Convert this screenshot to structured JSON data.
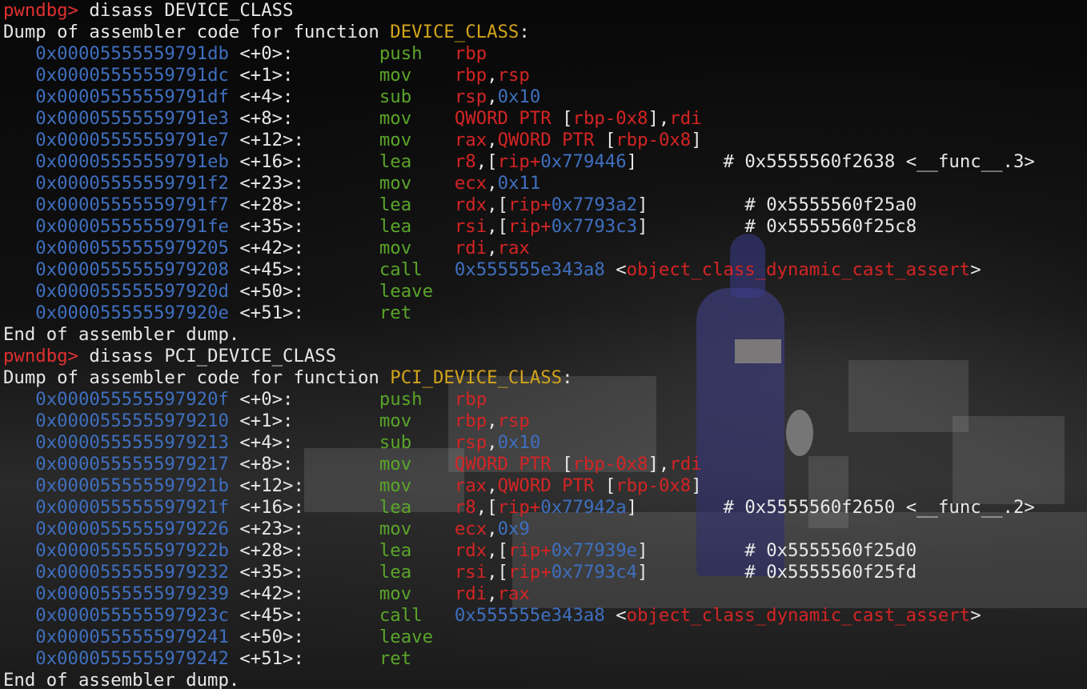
{
  "terminal": {
    "prompt": "pwndbg>",
    "sections": [
      {
        "command": "disass DEVICE_CLASS",
        "header_prefix": "Dump of assembler code for function ",
        "function": "DEVICE_CLASS",
        "header_suffix": ":",
        "rows": [
          {
            "addr": "0x00005555559791db",
            "off": "<+0>:",
            "mn": "push",
            "ops": [
              {
                "t": "rbp",
                "c": "reg"
              }
            ],
            "comment": ""
          },
          {
            "addr": "0x00005555559791dc",
            "off": "<+1>:",
            "mn": "mov",
            "ops": [
              {
                "t": "rbp",
                "c": "reg"
              },
              {
                "t": ",",
                "c": "plain"
              },
              {
                "t": "rsp",
                "c": "reg"
              }
            ],
            "comment": ""
          },
          {
            "addr": "0x00005555559791df",
            "off": "<+4>:",
            "mn": "sub",
            "ops": [
              {
                "t": "rsp",
                "c": "reg"
              },
              {
                "t": ",",
                "c": "plain"
              },
              {
                "t": "0x10",
                "c": "num"
              }
            ],
            "comment": ""
          },
          {
            "addr": "0x00005555559791e3",
            "off": "<+8>:",
            "mn": "mov",
            "ops": [
              {
                "t": "QWORD PTR",
                "c": "reg"
              },
              {
                "t": " [",
                "c": "plain"
              },
              {
                "t": "rbp-0x8",
                "c": "reg"
              },
              {
                "t": "],",
                "c": "plain"
              },
              {
                "t": "rdi",
                "c": "reg"
              }
            ],
            "comment": ""
          },
          {
            "addr": "0x00005555559791e7",
            "off": "<+12>:",
            "mn": "mov",
            "ops": [
              {
                "t": "rax",
                "c": "reg"
              },
              {
                "t": ",",
                "c": "plain"
              },
              {
                "t": "QWORD PTR",
                "c": "reg"
              },
              {
                "t": " [",
                "c": "plain"
              },
              {
                "t": "rbp-0x8",
                "c": "reg"
              },
              {
                "t": "]",
                "c": "plain"
              }
            ],
            "comment": ""
          },
          {
            "addr": "0x00005555559791eb",
            "off": "<+16>:",
            "mn": "lea",
            "ops": [
              {
                "t": "r8",
                "c": "reg"
              },
              {
                "t": ",[",
                "c": "plain"
              },
              {
                "t": "rip+",
                "c": "reg"
              },
              {
                "t": "0x779446",
                "c": "num"
              },
              {
                "t": "]",
                "c": "plain"
              }
            ],
            "comment": "        # 0x5555560f2638 <__func__.3>"
          },
          {
            "addr": "0x00005555559791f2",
            "off": "<+23>:",
            "mn": "mov",
            "ops": [
              {
                "t": "ecx",
                "c": "reg"
              },
              {
                "t": ",",
                "c": "plain"
              },
              {
                "t": "0x11",
                "c": "num"
              }
            ],
            "comment": ""
          },
          {
            "addr": "0x00005555559791f7",
            "off": "<+28>:",
            "mn": "lea",
            "ops": [
              {
                "t": "rdx",
                "c": "reg"
              },
              {
                "t": ",[",
                "c": "plain"
              },
              {
                "t": "rip+",
                "c": "reg"
              },
              {
                "t": "0x7793a2",
                "c": "num"
              },
              {
                "t": "]",
                "c": "plain"
              }
            ],
            "comment": "         # 0x5555560f25a0"
          },
          {
            "addr": "0x00005555559791fe",
            "off": "<+35>:",
            "mn": "lea",
            "ops": [
              {
                "t": "rsi",
                "c": "reg"
              },
              {
                "t": ",[",
                "c": "plain"
              },
              {
                "t": "rip+",
                "c": "reg"
              },
              {
                "t": "0x7793c3",
                "c": "num"
              },
              {
                "t": "]",
                "c": "plain"
              }
            ],
            "comment": "         # 0x5555560f25c8"
          },
          {
            "addr": "0x0000555555979205",
            "off": "<+42>:",
            "mn": "mov",
            "ops": [
              {
                "t": "rdi",
                "c": "reg"
              },
              {
                "t": ",",
                "c": "plain"
              },
              {
                "t": "rax",
                "c": "reg"
              }
            ],
            "comment": ""
          },
          {
            "addr": "0x0000555555979208",
            "off": "<+45>:",
            "mn": "call",
            "ops": [
              {
                "t": "0x555555e343a8",
                "c": "num"
              },
              {
                "t": " <",
                "c": "plain"
              },
              {
                "t": "object_class_dynamic_cast_assert",
                "c": "reg"
              },
              {
                "t": ">",
                "c": "plain"
              }
            ],
            "comment": ""
          },
          {
            "addr": "0x000055555597920d",
            "off": "<+50>:",
            "mn": "leave",
            "ops": [],
            "comment": ""
          },
          {
            "addr": "0x000055555597920e",
            "off": "<+51>:",
            "mn": "ret",
            "ops": [],
            "comment": ""
          }
        ],
        "footer": "End of assembler dump."
      },
      {
        "command": "disass PCI_DEVICE_CLASS",
        "header_prefix": "Dump of assembler code for function ",
        "function": "PCI_DEVICE_CLASS",
        "header_suffix": ":",
        "rows": [
          {
            "addr": "0x000055555597920f",
            "off": "<+0>:",
            "mn": "push",
            "ops": [
              {
                "t": "rbp",
                "c": "reg"
              }
            ],
            "comment": ""
          },
          {
            "addr": "0x0000555555979210",
            "off": "<+1>:",
            "mn": "mov",
            "ops": [
              {
                "t": "rbp",
                "c": "reg"
              },
              {
                "t": ",",
                "c": "plain"
              },
              {
                "t": "rsp",
                "c": "reg"
              }
            ],
            "comment": ""
          },
          {
            "addr": "0x0000555555979213",
            "off": "<+4>:",
            "mn": "sub",
            "ops": [
              {
                "t": "rsp",
                "c": "reg"
              },
              {
                "t": ",",
                "c": "plain"
              },
              {
                "t": "0x10",
                "c": "num"
              }
            ],
            "comment": ""
          },
          {
            "addr": "0x0000555555979217",
            "off": "<+8>:",
            "mn": "mov",
            "ops": [
              {
                "t": "QWORD PTR",
                "c": "reg"
              },
              {
                "t": " [",
                "c": "plain"
              },
              {
                "t": "rbp-0x8",
                "c": "reg"
              },
              {
                "t": "],",
                "c": "plain"
              },
              {
                "t": "rdi",
                "c": "reg"
              }
            ],
            "comment": ""
          },
          {
            "addr": "0x000055555597921b",
            "off": "<+12>:",
            "mn": "mov",
            "ops": [
              {
                "t": "rax",
                "c": "reg"
              },
              {
                "t": ",",
                "c": "plain"
              },
              {
                "t": "QWORD PTR",
                "c": "reg"
              },
              {
                "t": " [",
                "c": "plain"
              },
              {
                "t": "rbp-0x8",
                "c": "reg"
              },
              {
                "t": "]",
                "c": "plain"
              }
            ],
            "comment": ""
          },
          {
            "addr": "0x000055555597921f",
            "off": "<+16>:",
            "mn": "lea",
            "ops": [
              {
                "t": "r8",
                "c": "reg"
              },
              {
                "t": ",[",
                "c": "plain"
              },
              {
                "t": "rip+",
                "c": "reg"
              },
              {
                "t": "0x77942a",
                "c": "num"
              },
              {
                "t": "]",
                "c": "plain"
              }
            ],
            "comment": "        # 0x5555560f2650 <__func__.2>"
          },
          {
            "addr": "0x0000555555979226",
            "off": "<+23>:",
            "mn": "mov",
            "ops": [
              {
                "t": "ecx",
                "c": "reg"
              },
              {
                "t": ",",
                "c": "plain"
              },
              {
                "t": "0x9",
                "c": "num"
              }
            ],
            "comment": ""
          },
          {
            "addr": "0x000055555597922b",
            "off": "<+28>:",
            "mn": "lea",
            "ops": [
              {
                "t": "rdx",
                "c": "reg"
              },
              {
                "t": ",[",
                "c": "plain"
              },
              {
                "t": "rip+",
                "c": "reg"
              },
              {
                "t": "0x77939e",
                "c": "num"
              },
              {
                "t": "]",
                "c": "plain"
              }
            ],
            "comment": "         # 0x5555560f25d0"
          },
          {
            "addr": "0x0000555555979232",
            "off": "<+35>:",
            "mn": "lea",
            "ops": [
              {
                "t": "rsi",
                "c": "reg"
              },
              {
                "t": ",[",
                "c": "plain"
              },
              {
                "t": "rip+",
                "c": "reg"
              },
              {
                "t": "0x7793c4",
                "c": "num"
              },
              {
                "t": "]",
                "c": "plain"
              }
            ],
            "comment": "         # 0x5555560f25fd"
          },
          {
            "addr": "0x0000555555979239",
            "off": "<+42>:",
            "mn": "mov",
            "ops": [
              {
                "t": "rdi",
                "c": "reg"
              },
              {
                "t": ",",
                "c": "plain"
              },
              {
                "t": "rax",
                "c": "reg"
              }
            ],
            "comment": ""
          },
          {
            "addr": "0x000055555597923c",
            "off": "<+45>:",
            "mn": "call",
            "ops": [
              {
                "t": "0x555555e343a8",
                "c": "num"
              },
              {
                "t": " <",
                "c": "plain"
              },
              {
                "t": "object_class_dynamic_cast_assert",
                "c": "reg"
              },
              {
                "t": ">",
                "c": "plain"
              }
            ],
            "comment": ""
          },
          {
            "addr": "0x0000555555979241",
            "off": "<+50>:",
            "mn": "leave",
            "ops": [],
            "comment": ""
          },
          {
            "addr": "0x0000555555979242",
            "off": "<+51>:",
            "mn": "ret",
            "ops": [],
            "comment": ""
          }
        ],
        "footer": "End of assembler dump."
      }
    ]
  },
  "colors": {
    "prompt": "#e03030",
    "function_name": "#d4a51a",
    "address": "#3f6fbf",
    "mnemonic": "#5aa52a",
    "register": "#d42424",
    "text": "#e8e8e8"
  }
}
